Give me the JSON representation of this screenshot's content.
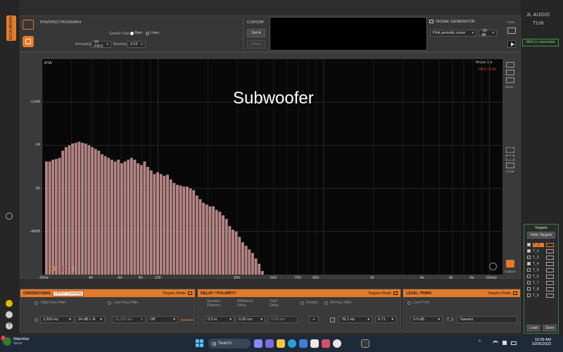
{
  "toolbar": {
    "rta_title": "RTA/SPECTROGRAPH",
    "sample_data_label": "Sample Data",
    "radio_bars": "Bars",
    "radio_lines": "Lines",
    "averaging_label": "Averaging",
    "averaging_value": "16 FIFO",
    "banding_label": "Banding",
    "banding_value": "1/12",
    "cursor_title": "CURSOR",
    "set_a": "Set A",
    "clear": "Clear",
    "signal_generator_title": "SIGNAL GENERATOR",
    "signal_type": "Pink periodic noise",
    "signal_level": "-15 dB"
  },
  "right": {
    "brand_line1": "JL AUDIO",
    "brand_line2": "TUN",
    "ports_label": "Ports",
    "max_status": "MAX is connected",
    "zoom_label": "Zoom",
    "scale_label": "Scale",
    "capture_label": "Capture"
  },
  "left_strip": {
    "tab_label": "RECALIBRATE"
  },
  "graph": {
    "title": "Subwoofer",
    "rta_label": "RTA",
    "channel_select": "Hi-Lev 1",
    "offset_label": "Off ft",
    "offset_value": "+0.00",
    "y_labels": [
      "-12dB",
      "-24",
      "-36",
      "-48dB"
    ],
    "x_labels": [
      "20Hz",
      "40",
      "60",
      "80",
      "100",
      "300",
      "500",
      "700",
      "900",
      "2k",
      "4k",
      "6k",
      "8k",
      "10kHz"
    ]
  },
  "chart_data": {
    "type": "bar",
    "x_scale": "log",
    "ylabel": "",
    "xlabel": "",
    "bar_color": "#d9a0a0",
    "values_db": [
      -30.5,
      -30.5,
      -30,
      -29.8,
      -29.5,
      -27.5,
      -26.5,
      -26,
      -25.5,
      -25.3,
      -25,
      -25.3,
      -25.5,
      -26,
      -26.5,
      -27,
      -27.5,
      -28.5,
      -29,
      -29.5,
      -30,
      -30.5,
      -30,
      -31,
      -30.5,
      -30,
      -29.5,
      -30,
      -31,
      -31.5,
      -30.5,
      -32,
      -33,
      -34,
      -33.5,
      -34,
      -34.5,
      -34.2,
      -35.5,
      -36.5,
      -37,
      -37.2,
      -37.5,
      -37.5,
      -38,
      -38.5,
      -40,
      -41,
      -42,
      -42.5,
      -43,
      -43,
      -44,
      -44.5,
      -45.5,
      -46.5,
      -48.5,
      -49.5,
      -50,
      -51.5,
      -53,
      -54,
      -55,
      -56,
      -57.5,
      -59,
      -61,
      -62
    ],
    "y_range_db": [
      -62,
      -2
    ]
  },
  "crossovers": {
    "title": "CROSSOVERS",
    "tab": "HP/LP Tracking",
    "mode": "Targets Mode",
    "hp_label": "High-Pass Filter",
    "lp_label": "Low-Pass Filter",
    "freq1": "2,500 Hz",
    "slope1": "24 dB L-R",
    "freq2": "20,000 Hz",
    "slope2": "Off"
  },
  "delay": {
    "title": "DELAY / POLARITY",
    "mode": "Targets Mode",
    "speaker_distance_label": "Speaker Distance",
    "additional_delay_label": "Additional Delay",
    "total_delay_label": "Total Delay",
    "polarity_label": "Polarity",
    "allpass_label": "All-Pass Filter",
    "distance": "0.0 in",
    "additional": "0.00 ms",
    "total": "0.00 ms",
    "allpass_freq": "78.1 Hz",
    "allpass_q": "0.71",
    "polarity_sign": "+"
  },
  "level": {
    "title": "LEVEL TRIMS",
    "mode": "Targets Mode",
    "level_trim_label": "Level Trim",
    "level_value": "0.0 dB",
    "channel": "T_1",
    "channel_name": "Tweeter"
  },
  "targets": {
    "title": "Targets",
    "hide": "Hide Targets",
    "items": [
      "T_1",
      "T_2",
      "T_3",
      "T_4",
      "T_5",
      "T_6",
      "T_7",
      "T_8",
      "T_9"
    ],
    "load": "Load",
    "save": "Save"
  },
  "taskbar": {
    "watchlist_title": "Watchlist",
    "watchlist_sub": "Ideas",
    "search": "Search",
    "time": "10:39 AM",
    "date": "10/26/2023",
    "notification_badge": "1"
  },
  "colors": {
    "accent": "#e47b2a",
    "bar": "#d9a0a0",
    "graph_bg": "#080808",
    "status_green": "#3f9a3f"
  }
}
